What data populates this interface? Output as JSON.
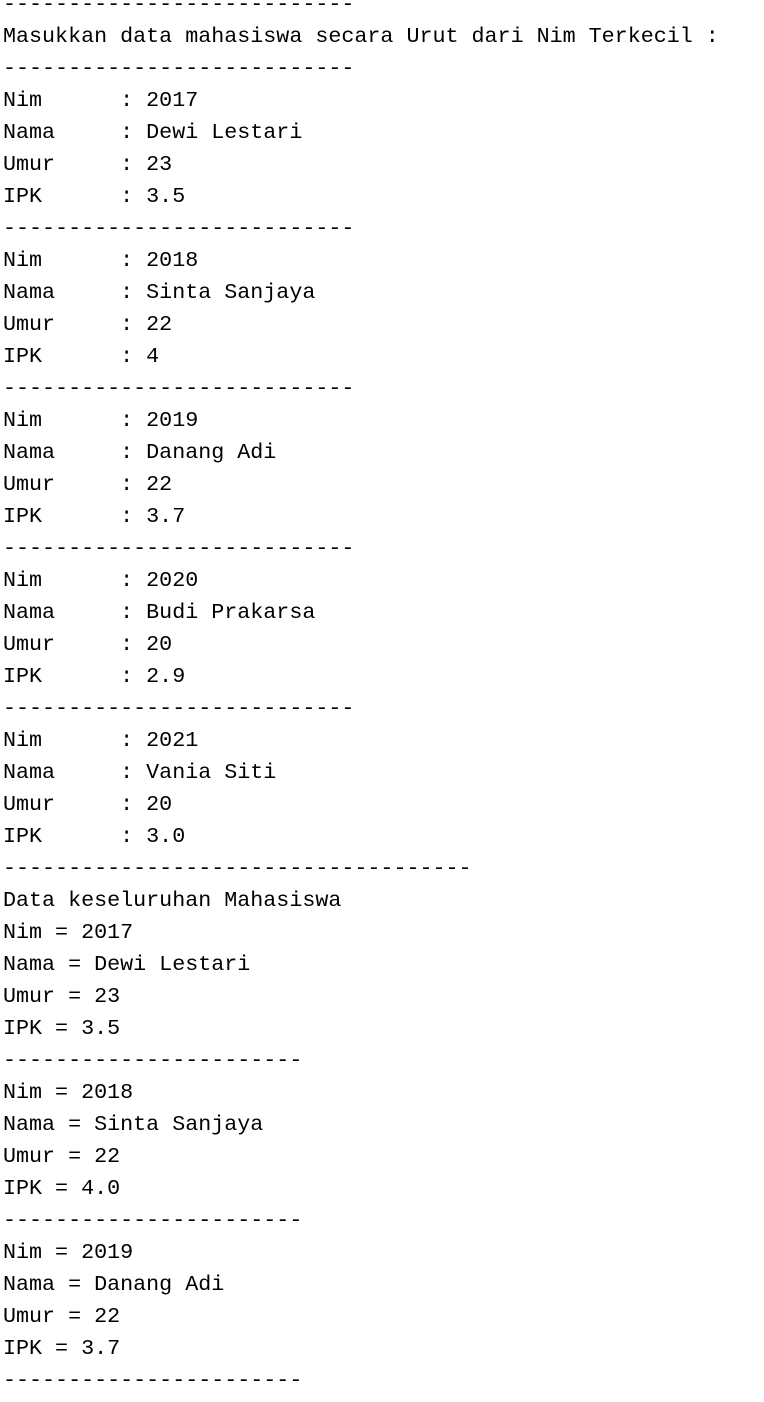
{
  "console": {
    "lines": [
      "---------------------------",
      "Masukkan data mahasiswa secara Urut dari Nim Terkecil :",
      "---------------------------",
      "Nim      : 2017",
      "Nama     : Dewi Lestari",
      "Umur     : 23",
      "IPK      : 3.5",
      "---------------------------",
      "Nim      : 2018",
      "Nama     : Sinta Sanjaya",
      "Umur     : 22",
      "IPK      : 4",
      "---------------------------",
      "Nim      : 2019",
      "Nama     : Danang Adi",
      "Umur     : 22",
      "IPK      : 3.7",
      "---------------------------",
      "Nim      : 2020",
      "Nama     : Budi Prakarsa",
      "Umur     : 20",
      "IPK      : 2.9",
      "---------------------------",
      "Nim      : 2021",
      "Nama     : Vania Siti",
      "Umur     : 20",
      "IPK      : 3.0",
      "------------------------------------",
      "Data keseluruhan Mahasiswa",
      "Nim = 2017",
      "Nama = Dewi Lestari",
      "Umur = 23",
      "IPK = 3.5",
      "-----------------------",
      "Nim = 2018",
      "Nama = Sinta Sanjaya",
      "Umur = 22",
      "IPK = 4.0",
      "-----------------------",
      "Nim = 2019",
      "Nama = Danang Adi",
      "Umur = 22",
      "IPK = 3.7",
      "-----------------------"
    ]
  }
}
